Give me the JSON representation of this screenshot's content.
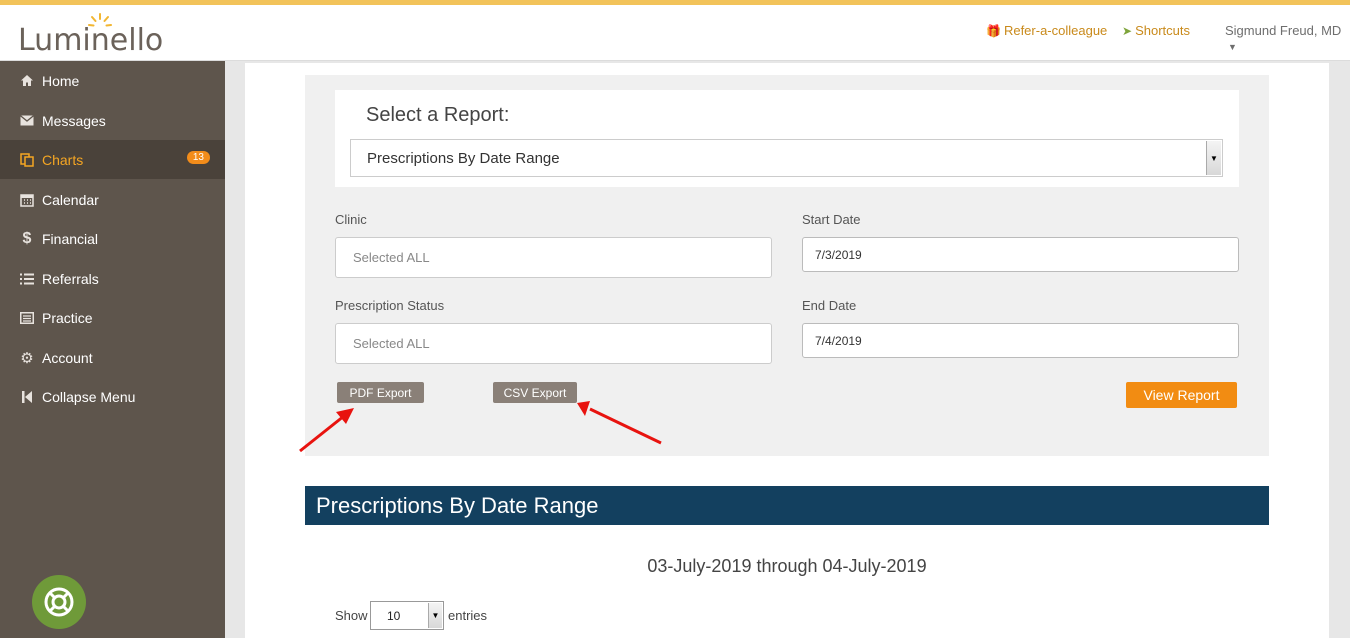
{
  "brand": {
    "name": "Luminello"
  },
  "header": {
    "refer_label": "Refer-a-colleague",
    "shortcuts_label": "Shortcuts",
    "user_name": "Sigmund Freud, MD"
  },
  "sidebar": {
    "items": [
      {
        "label": "Home",
        "icon": "home-icon"
      },
      {
        "label": "Messages",
        "icon": "envelope-icon"
      },
      {
        "label": "Charts",
        "icon": "copy-icon",
        "badge": "13"
      },
      {
        "label": "Calendar",
        "icon": "calendar-icon"
      },
      {
        "label": "Financial",
        "icon": "dollar-icon"
      },
      {
        "label": "Referrals",
        "icon": "list-icon"
      },
      {
        "label": "Practice",
        "icon": "list-alt-icon"
      },
      {
        "label": "Account",
        "icon": "gear-icon"
      },
      {
        "label": "Collapse Menu",
        "icon": "step-backward-icon"
      }
    ]
  },
  "report": {
    "title": "Select a Report:",
    "selected": "Prescriptions By Date Range"
  },
  "filters": {
    "clinic_label": "Clinic",
    "clinic_value": "Selected ALL",
    "status_label": "Prescription Status",
    "status_value": "Selected ALL",
    "start_label": "Start Date",
    "start_value": "7/3/2019",
    "end_label": "End Date",
    "end_value": "7/4/2019"
  },
  "actions": {
    "pdf_label": "PDF Export",
    "csv_label": "CSV Export",
    "view_label": "View Report"
  },
  "results": {
    "title": "Prescriptions By Date Range",
    "range_text": "03-July-2019 through 04-July-2019",
    "show_label": "Show",
    "entries_value": "10",
    "entries_label": "entries"
  },
  "colors": {
    "accent": "#f28c12",
    "sidebar": "#5e554c",
    "header_bar": "#13405f",
    "help": "#6f9a39"
  }
}
